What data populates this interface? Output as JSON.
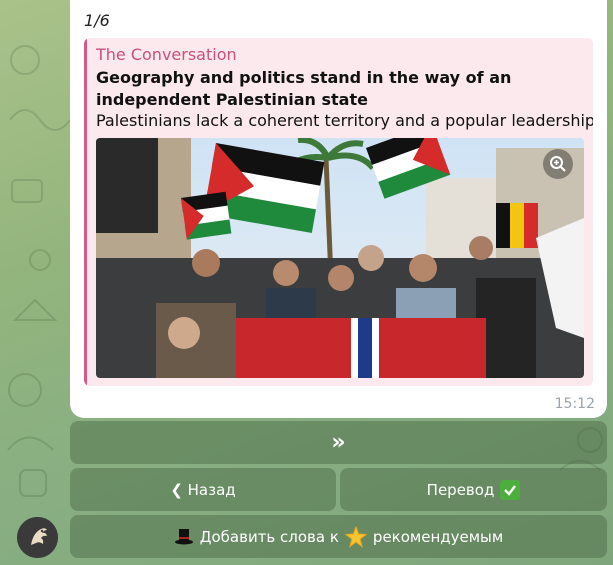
{
  "message": {
    "counter": "1/6",
    "time": "15:12",
    "preview": {
      "site_name": "The Conversation",
      "title": "Geography and politics stand in the way of an independent Palestinian state",
      "description": "Palestinians lack a coherent territory and a popular leadership."
    }
  },
  "keyboard": {
    "next_label": "»",
    "back_label": "❮ Назад",
    "translate_label": "Перевод",
    "add_words_prefix": "Добавить слова к",
    "add_words_suffix": "рекомендуемым"
  },
  "colors": {
    "accent": "#cc4f7c",
    "bubble": "#ffffff",
    "keyboard_button": "#5b7a52"
  },
  "icons": {
    "zoom": "zoom-in-icon",
    "check": "check-mark-button-icon",
    "top_hat": "top-hat-icon",
    "star": "glowing-star-icon"
  }
}
